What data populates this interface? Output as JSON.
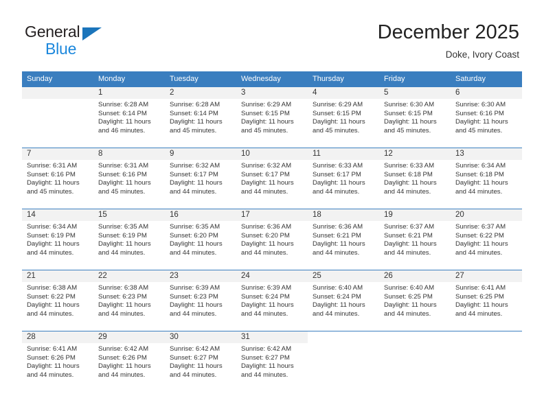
{
  "brand": {
    "name_part1": "General",
    "name_part2": "Blue",
    "triangle_color": "#1b75bb",
    "blue_color": "#1b87dc"
  },
  "header": {
    "title": "December 2025",
    "subtitle": "Doke, Ivory Coast"
  },
  "theme": {
    "header_bg": "#3a7ebf",
    "daynum_bg": "#f2f2f2",
    "text": "#333333"
  },
  "calendar": {
    "weekdays": [
      "Sunday",
      "Monday",
      "Tuesday",
      "Wednesday",
      "Thursday",
      "Friday",
      "Saturday"
    ],
    "weeks": [
      [
        {
          "day": "",
          "lines": []
        },
        {
          "day": "1",
          "lines": [
            "Sunrise: 6:28 AM",
            "Sunset: 6:14 PM",
            "Daylight: 11 hours",
            "and 46 minutes."
          ]
        },
        {
          "day": "2",
          "lines": [
            "Sunrise: 6:28 AM",
            "Sunset: 6:14 PM",
            "Daylight: 11 hours",
            "and 45 minutes."
          ]
        },
        {
          "day": "3",
          "lines": [
            "Sunrise: 6:29 AM",
            "Sunset: 6:15 PM",
            "Daylight: 11 hours",
            "and 45 minutes."
          ]
        },
        {
          "day": "4",
          "lines": [
            "Sunrise: 6:29 AM",
            "Sunset: 6:15 PM",
            "Daylight: 11 hours",
            "and 45 minutes."
          ]
        },
        {
          "day": "5",
          "lines": [
            "Sunrise: 6:30 AM",
            "Sunset: 6:15 PM",
            "Daylight: 11 hours",
            "and 45 minutes."
          ]
        },
        {
          "day": "6",
          "lines": [
            "Sunrise: 6:30 AM",
            "Sunset: 6:16 PM",
            "Daylight: 11 hours",
            "and 45 minutes."
          ]
        }
      ],
      [
        {
          "day": "7",
          "lines": [
            "Sunrise: 6:31 AM",
            "Sunset: 6:16 PM",
            "Daylight: 11 hours",
            "and 45 minutes."
          ]
        },
        {
          "day": "8",
          "lines": [
            "Sunrise: 6:31 AM",
            "Sunset: 6:16 PM",
            "Daylight: 11 hours",
            "and 45 minutes."
          ]
        },
        {
          "day": "9",
          "lines": [
            "Sunrise: 6:32 AM",
            "Sunset: 6:17 PM",
            "Daylight: 11 hours",
            "and 44 minutes."
          ]
        },
        {
          "day": "10",
          "lines": [
            "Sunrise: 6:32 AM",
            "Sunset: 6:17 PM",
            "Daylight: 11 hours",
            "and 44 minutes."
          ]
        },
        {
          "day": "11",
          "lines": [
            "Sunrise: 6:33 AM",
            "Sunset: 6:17 PM",
            "Daylight: 11 hours",
            "and 44 minutes."
          ]
        },
        {
          "day": "12",
          "lines": [
            "Sunrise: 6:33 AM",
            "Sunset: 6:18 PM",
            "Daylight: 11 hours",
            "and 44 minutes."
          ]
        },
        {
          "day": "13",
          "lines": [
            "Sunrise: 6:34 AM",
            "Sunset: 6:18 PM",
            "Daylight: 11 hours",
            "and 44 minutes."
          ]
        }
      ],
      [
        {
          "day": "14",
          "lines": [
            "Sunrise: 6:34 AM",
            "Sunset: 6:19 PM",
            "Daylight: 11 hours",
            "and 44 minutes."
          ]
        },
        {
          "day": "15",
          "lines": [
            "Sunrise: 6:35 AM",
            "Sunset: 6:19 PM",
            "Daylight: 11 hours",
            "and 44 minutes."
          ]
        },
        {
          "day": "16",
          "lines": [
            "Sunrise: 6:35 AM",
            "Sunset: 6:20 PM",
            "Daylight: 11 hours",
            "and 44 minutes."
          ]
        },
        {
          "day": "17",
          "lines": [
            "Sunrise: 6:36 AM",
            "Sunset: 6:20 PM",
            "Daylight: 11 hours",
            "and 44 minutes."
          ]
        },
        {
          "day": "18",
          "lines": [
            "Sunrise: 6:36 AM",
            "Sunset: 6:21 PM",
            "Daylight: 11 hours",
            "and 44 minutes."
          ]
        },
        {
          "day": "19",
          "lines": [
            "Sunrise: 6:37 AM",
            "Sunset: 6:21 PM",
            "Daylight: 11 hours",
            "and 44 minutes."
          ]
        },
        {
          "day": "20",
          "lines": [
            "Sunrise: 6:37 AM",
            "Sunset: 6:22 PM",
            "Daylight: 11 hours",
            "and 44 minutes."
          ]
        }
      ],
      [
        {
          "day": "21",
          "lines": [
            "Sunrise: 6:38 AM",
            "Sunset: 6:22 PM",
            "Daylight: 11 hours",
            "and 44 minutes."
          ]
        },
        {
          "day": "22",
          "lines": [
            "Sunrise: 6:38 AM",
            "Sunset: 6:23 PM",
            "Daylight: 11 hours",
            "and 44 minutes."
          ]
        },
        {
          "day": "23",
          "lines": [
            "Sunrise: 6:39 AM",
            "Sunset: 6:23 PM",
            "Daylight: 11 hours",
            "and 44 minutes."
          ]
        },
        {
          "day": "24",
          "lines": [
            "Sunrise: 6:39 AM",
            "Sunset: 6:24 PM",
            "Daylight: 11 hours",
            "and 44 minutes."
          ]
        },
        {
          "day": "25",
          "lines": [
            "Sunrise: 6:40 AM",
            "Sunset: 6:24 PM",
            "Daylight: 11 hours",
            "and 44 minutes."
          ]
        },
        {
          "day": "26",
          "lines": [
            "Sunrise: 6:40 AM",
            "Sunset: 6:25 PM",
            "Daylight: 11 hours",
            "and 44 minutes."
          ]
        },
        {
          "day": "27",
          "lines": [
            "Sunrise: 6:41 AM",
            "Sunset: 6:25 PM",
            "Daylight: 11 hours",
            "and 44 minutes."
          ]
        }
      ],
      [
        {
          "day": "28",
          "lines": [
            "Sunrise: 6:41 AM",
            "Sunset: 6:26 PM",
            "Daylight: 11 hours",
            "and 44 minutes."
          ]
        },
        {
          "day": "29",
          "lines": [
            "Sunrise: 6:42 AM",
            "Sunset: 6:26 PM",
            "Daylight: 11 hours",
            "and 44 minutes."
          ]
        },
        {
          "day": "30",
          "lines": [
            "Sunrise: 6:42 AM",
            "Sunset: 6:27 PM",
            "Daylight: 11 hours",
            "and 44 minutes."
          ]
        },
        {
          "day": "31",
          "lines": [
            "Sunrise: 6:42 AM",
            "Sunset: 6:27 PM",
            "Daylight: 11 hours",
            "and 44 minutes."
          ]
        },
        {
          "day": "",
          "lines": []
        },
        {
          "day": "",
          "lines": []
        },
        {
          "day": "",
          "lines": []
        }
      ]
    ]
  }
}
